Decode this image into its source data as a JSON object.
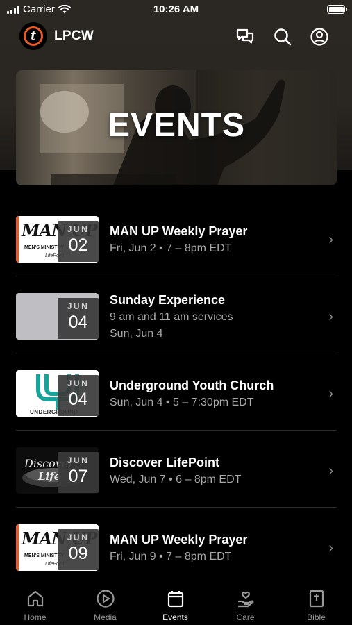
{
  "status_bar": {
    "carrier": "Carrier",
    "time": "10:26 AM"
  },
  "header": {
    "app_name": "LPCW",
    "logo_letter": "t"
  },
  "banner": {
    "title": "EVENTS"
  },
  "events": [
    {
      "title": "MAN UP Weekly Prayer",
      "line1": "Fri, Jun 2 • 7 – 8pm EDT",
      "line2": "",
      "month": "JUN",
      "day": "02",
      "thumb": "manup"
    },
    {
      "title": "Sunday Experience",
      "line1": "9 am and 11 am services",
      "line2": "Sun, Jun 4",
      "month": "JUN",
      "day": "04",
      "thumb": "gray"
    },
    {
      "title": "Underground Youth Church",
      "line1": "Sun, Jun 4 • 5 – 7:30pm EDT",
      "line2": "",
      "month": "JUN",
      "day": "04",
      "thumb": "underground"
    },
    {
      "title": "Discover LifePoint",
      "line1": "Wed, Jun 7 • 6 – 8pm EDT",
      "line2": "",
      "month": "JUN",
      "day": "07",
      "thumb": "discover"
    },
    {
      "title": "MAN UP Weekly Prayer",
      "line1": "Fri, Jun 9 • 7 – 8pm EDT",
      "line2": "",
      "month": "JUN",
      "day": "09",
      "thumb": "manup"
    }
  ],
  "thumb_text": {
    "manup_big": "MAN UP",
    "manup_small": "MEN'S MINISTRY",
    "manup_brand": "LifePoint",
    "underground": "UNDERGROUND",
    "discover_1": "Discover",
    "discover_2": "Life"
  },
  "tabs": [
    {
      "label": "Home",
      "icon": "home-icon",
      "active": false
    },
    {
      "label": "Media",
      "icon": "play-circle-icon",
      "active": false
    },
    {
      "label": "Events",
      "icon": "calendar-icon",
      "active": true
    },
    {
      "label": "Care",
      "icon": "heart-hand-icon",
      "active": false
    },
    {
      "label": "Bible",
      "icon": "bible-icon",
      "active": false
    }
  ],
  "colors": {
    "accent": "#e85b24",
    "background": "#000000",
    "muted_text": "#a8a8a8"
  }
}
